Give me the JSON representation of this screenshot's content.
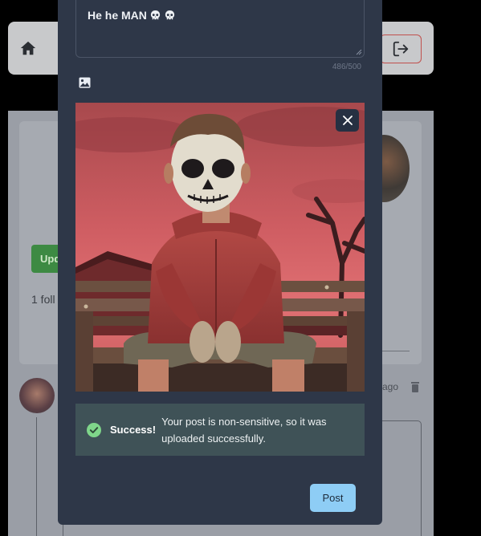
{
  "background": {
    "update_button_label": "Upd",
    "followers_text": "1 foll",
    "post_time": "ago"
  },
  "composer": {
    "text_value": "He he MAN",
    "emoji": [
      "💀",
      "💀"
    ],
    "char_count": "486/500",
    "success_title": "Success!",
    "success_message": "Your post is non-sensitive, so it was uploaded successfully.",
    "post_button_label": "Post"
  },
  "colors": {
    "modal_bg": "#2e3748",
    "alert_bg": "#3f5257",
    "success_icon": "#7fd68a",
    "post_button": "#8ecdf5",
    "update_button": "#3d8a43",
    "logout_border": "#c0504d"
  },
  "icons": {
    "home": "home-icon",
    "logout": "logout-icon",
    "image_attach": "image-icon",
    "close": "close-icon",
    "success": "check-circle-icon",
    "delete": "trash-icon"
  }
}
